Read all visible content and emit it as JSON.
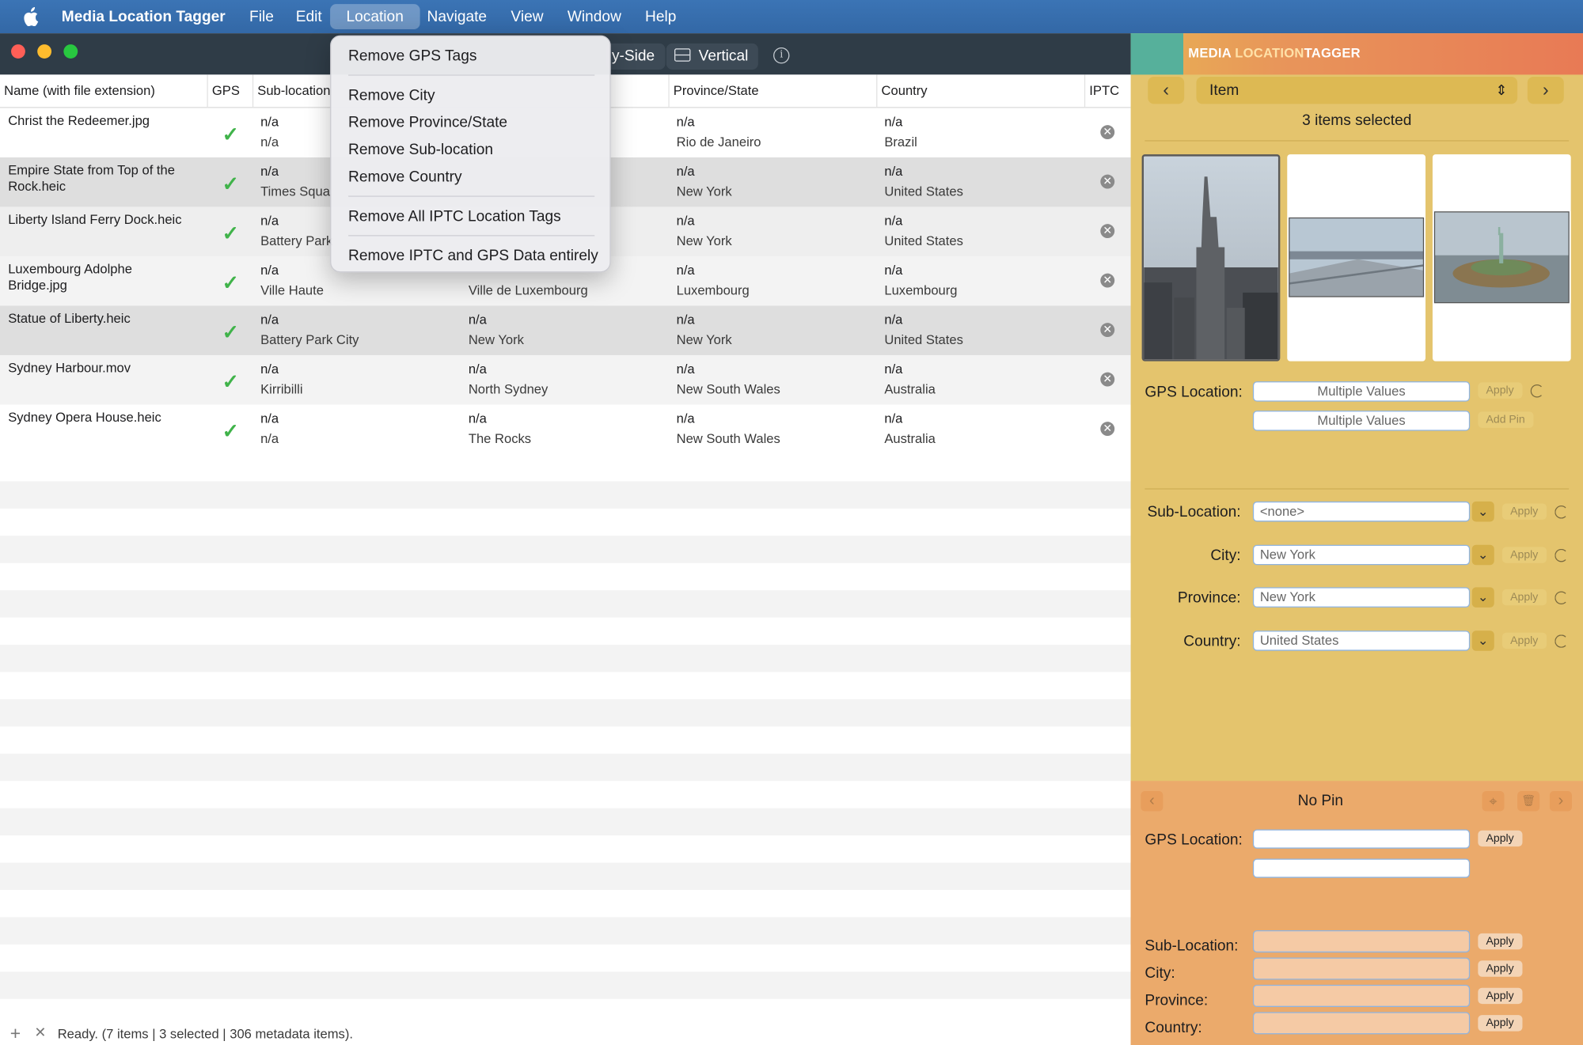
{
  "menubar": {
    "apple_icon": "apple-logo-icon",
    "app_name": "Media Location Tagger",
    "items": [
      "File",
      "Edit",
      "Location",
      "Navigate",
      "View",
      "Window",
      "Help"
    ]
  },
  "toolbar": {
    "side_label": "y-Side",
    "vertical_label": "Vertical",
    "info_glyph": "i"
  },
  "location_menu": {
    "items": [
      "Remove GPS Tags",
      "Remove City",
      "Remove Province/State",
      "Remove Sub-location",
      "Remove Country",
      "Remove All IPTC Location Tags",
      "Remove IPTC and GPS Data entirely"
    ]
  },
  "table": {
    "columns": [
      "Name (with file extension)",
      "GPS",
      "Sub-location",
      "Province/State",
      "Country",
      "IPTC"
    ],
    "gps_mark": "✓",
    "iptc_mark": "✕",
    "rows": [
      {
        "name": "Christ the Redeemer.jpg",
        "sub1": "n/a",
        "sub2": "n/a",
        "city1": "",
        "city2": "",
        "prov1": "n/a",
        "prov2": "Rio de Janeiro",
        "country1": "n/a",
        "country2": "Brazil"
      },
      {
        "name": "Empire State from Top of the Rock.heic",
        "sub1": "n/a",
        "sub2": "Times Squa",
        "city1": "",
        "city2": "",
        "prov1": "n/a",
        "prov2": "New York",
        "country1": "n/a",
        "country2": "United States"
      },
      {
        "name": "Liberty Island Ferry Dock.heic",
        "sub1": "n/a",
        "sub2": "Battery Park",
        "city1": "",
        "city2": "",
        "prov1": "n/a",
        "prov2": "New York",
        "country1": "n/a",
        "country2": "United States"
      },
      {
        "name": "Luxembourg Adolphe Bridge.jpg",
        "sub1": "n/a",
        "sub2": "Ville Haute",
        "city1": "",
        "city2": "Ville de Luxembourg",
        "prov1": "n/a",
        "prov2": "Luxembourg",
        "country1": "n/a",
        "country2": "Luxembourg"
      },
      {
        "name": "Statue of Liberty.heic",
        "sub1": "n/a",
        "sub2": "Battery Park City",
        "city1": "n/a",
        "city2": "New York",
        "prov1": "n/a",
        "prov2": "New York",
        "country1": "n/a",
        "country2": "United States"
      },
      {
        "name": "Sydney Harbour.mov",
        "sub1": "n/a",
        "sub2": "Kirribilli",
        "city1": "n/a",
        "city2": "North Sydney",
        "prov1": "n/a",
        "prov2": "New South Wales",
        "country1": "n/a",
        "country2": "Australia"
      },
      {
        "name": "Sydney Opera House.heic",
        "sub1": "n/a",
        "sub2": "n/a",
        "city1": "n/a",
        "city2": "The Rocks",
        "prov1": "n/a",
        "prov2": "New South Wales",
        "country1": "n/a",
        "country2": "Australia"
      }
    ]
  },
  "status": {
    "add_icon": "+",
    "remove_icon": "✕",
    "text": "Ready. (7 items | 3 selected | 306 metadata items)."
  },
  "panel": {
    "logo_part1": "MEDIA ",
    "logo_part2": "LOCATION",
    "logo_part3": "TAGGER",
    "prev_glyph": "‹",
    "next_glyph": "›",
    "item_label": "Item",
    "item_chevron": "⇕",
    "selected_text": "3 items selected",
    "gps_label": "GPS Location:",
    "gps_value1": "Multiple Values",
    "gps_value2": "Multiple Values",
    "apply_label": "Apply",
    "add_pin_label": "Add Pin",
    "sub_label": "Sub-Location:",
    "sub_value": "<none>",
    "city_label": "City:",
    "city_value": "New York",
    "province_label": "Province:",
    "province_value": "New York",
    "country_label": "Country:",
    "country_value": "United States",
    "dropdown_glyph": "⌄"
  },
  "pin": {
    "title": "No Pin",
    "gps_label": "GPS Location:",
    "apply_label": "Apply",
    "sub_label": "Sub-Location:",
    "city_label": "City:",
    "province_label": "Province:",
    "country_label": "Country:",
    "prev_glyph": "‹",
    "next_glyph": "›",
    "target_glyph": "⌖",
    "trash_glyph": "🗑"
  },
  "colors": {
    "menubar": "#3b74b5",
    "toolbar": "#2f3c47",
    "panel_yellow": "#e4c46d",
    "panel_orange": "#ebaa6b",
    "check_green": "#40b34a"
  }
}
